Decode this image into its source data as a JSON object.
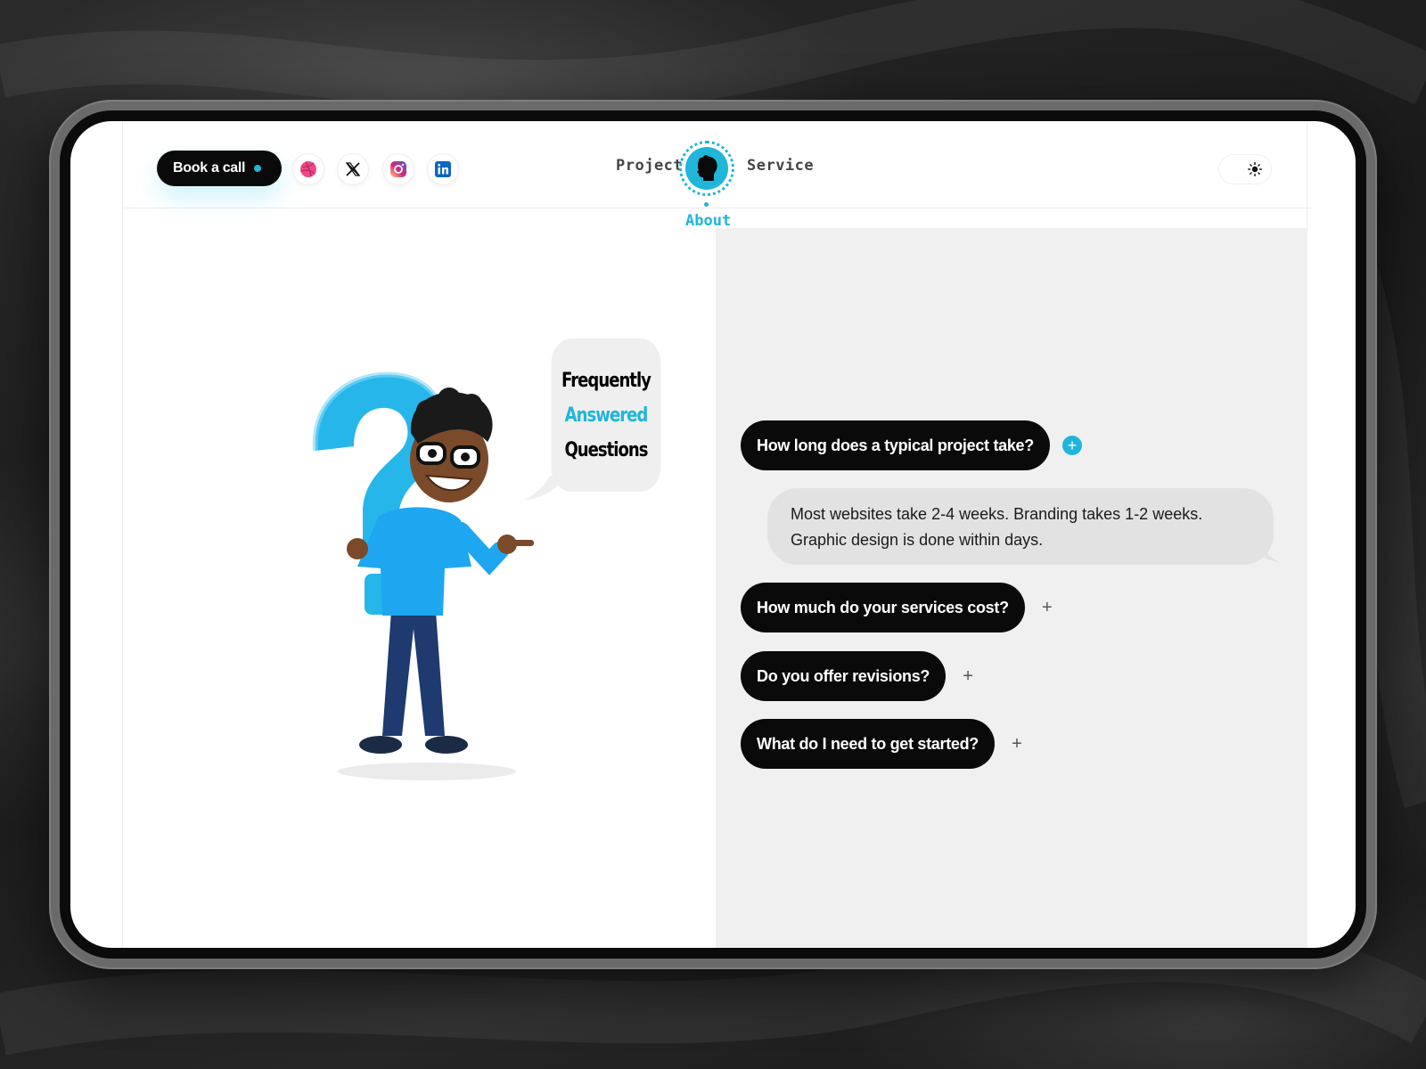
{
  "header": {
    "book_call_label": "Book a call",
    "social_links": [
      {
        "name": "dribbble",
        "icon": "dribbble-icon",
        "color": "#ea4c89"
      },
      {
        "name": "x",
        "icon": "x-icon",
        "color": "#111111"
      },
      {
        "name": "instagram",
        "icon": "instagram-icon",
        "color": "#e1306c"
      },
      {
        "name": "linkedin",
        "icon": "linkedin-icon",
        "color": "#0a66c2"
      }
    ],
    "nav": {
      "project": "Project",
      "service": "Service",
      "about": "About"
    },
    "theme_toggle_icon": "sun-icon"
  },
  "hero": {
    "bubble_line1": "Frequently",
    "bubble_line2": "Answered",
    "bubble_line3": "Questions"
  },
  "faq": {
    "items": [
      {
        "question": "How long does a typical project take?",
        "toggle": "+",
        "expanded": true
      },
      {
        "question": "How much do your services cost?",
        "toggle": "+",
        "expanded": false
      },
      {
        "question": "Do you offer revisions?",
        "toggle": "+",
        "expanded": false
      },
      {
        "question": "What do I need to get started?",
        "toggle": "+",
        "expanded": false
      }
    ],
    "answer": "Most websites take 2-4 weeks. Branding takes 1-2 weeks. Graphic design is done within days."
  },
  "colors": {
    "accent": "#1fb6d9",
    "dark": "#0a0a0a",
    "panel": "#f0f0f0"
  }
}
